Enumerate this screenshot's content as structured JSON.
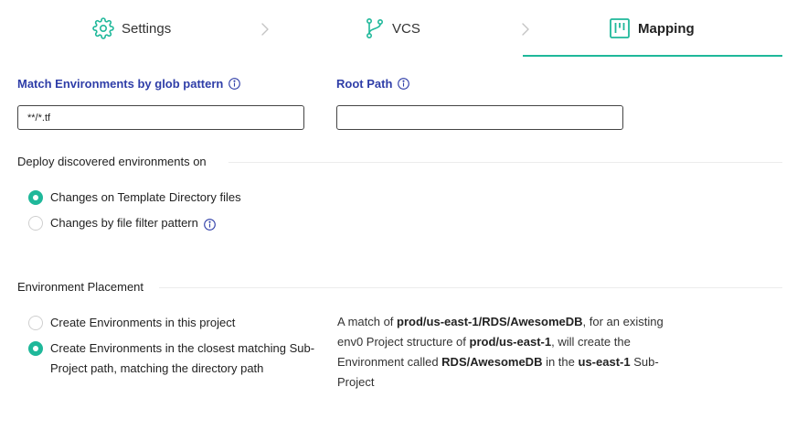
{
  "stepper": {
    "steps": [
      {
        "label": "Settings",
        "icon": "gear-icon",
        "active": false
      },
      {
        "label": "VCS",
        "icon": "git-branch-icon",
        "active": false
      },
      {
        "label": "Mapping",
        "icon": "kanban-board-icon",
        "active": true
      }
    ],
    "accent_color": "#1fb89a"
  },
  "fields": {
    "glob_label": "Match Environments by glob pattern",
    "glob_value": "**/*.tf",
    "root_label": "Root Path",
    "root_value": ""
  },
  "deploy": {
    "title": "Deploy discovered environments on",
    "options": [
      {
        "label": "Changes on Template Directory files",
        "checked": true
      },
      {
        "label": "Changes by file filter pattern",
        "checked": false
      }
    ]
  },
  "placement": {
    "title": "Environment Placement",
    "options": [
      {
        "label": "Create Environments in this project",
        "checked": false
      },
      {
        "label": "Create Environments in the closest matching Sub-Project path, matching the directory path",
        "checked": true
      }
    ],
    "description": {
      "t1": "A match of ",
      "b1": "prod/us-east-1/RDS/AwesomeDB",
      "t2": ", for an existing env0 Project structure of ",
      "b2": "prod/us-east-1",
      "t3": ", will create the Environment called ",
      "b3": "RDS/AwesomeDB",
      "t4": " in the ",
      "b4": "us-east-1",
      "t5": " Sub-Project"
    }
  },
  "colors": {
    "label_blue": "#2f3ea8",
    "radio_checked": "#1fb89a"
  }
}
